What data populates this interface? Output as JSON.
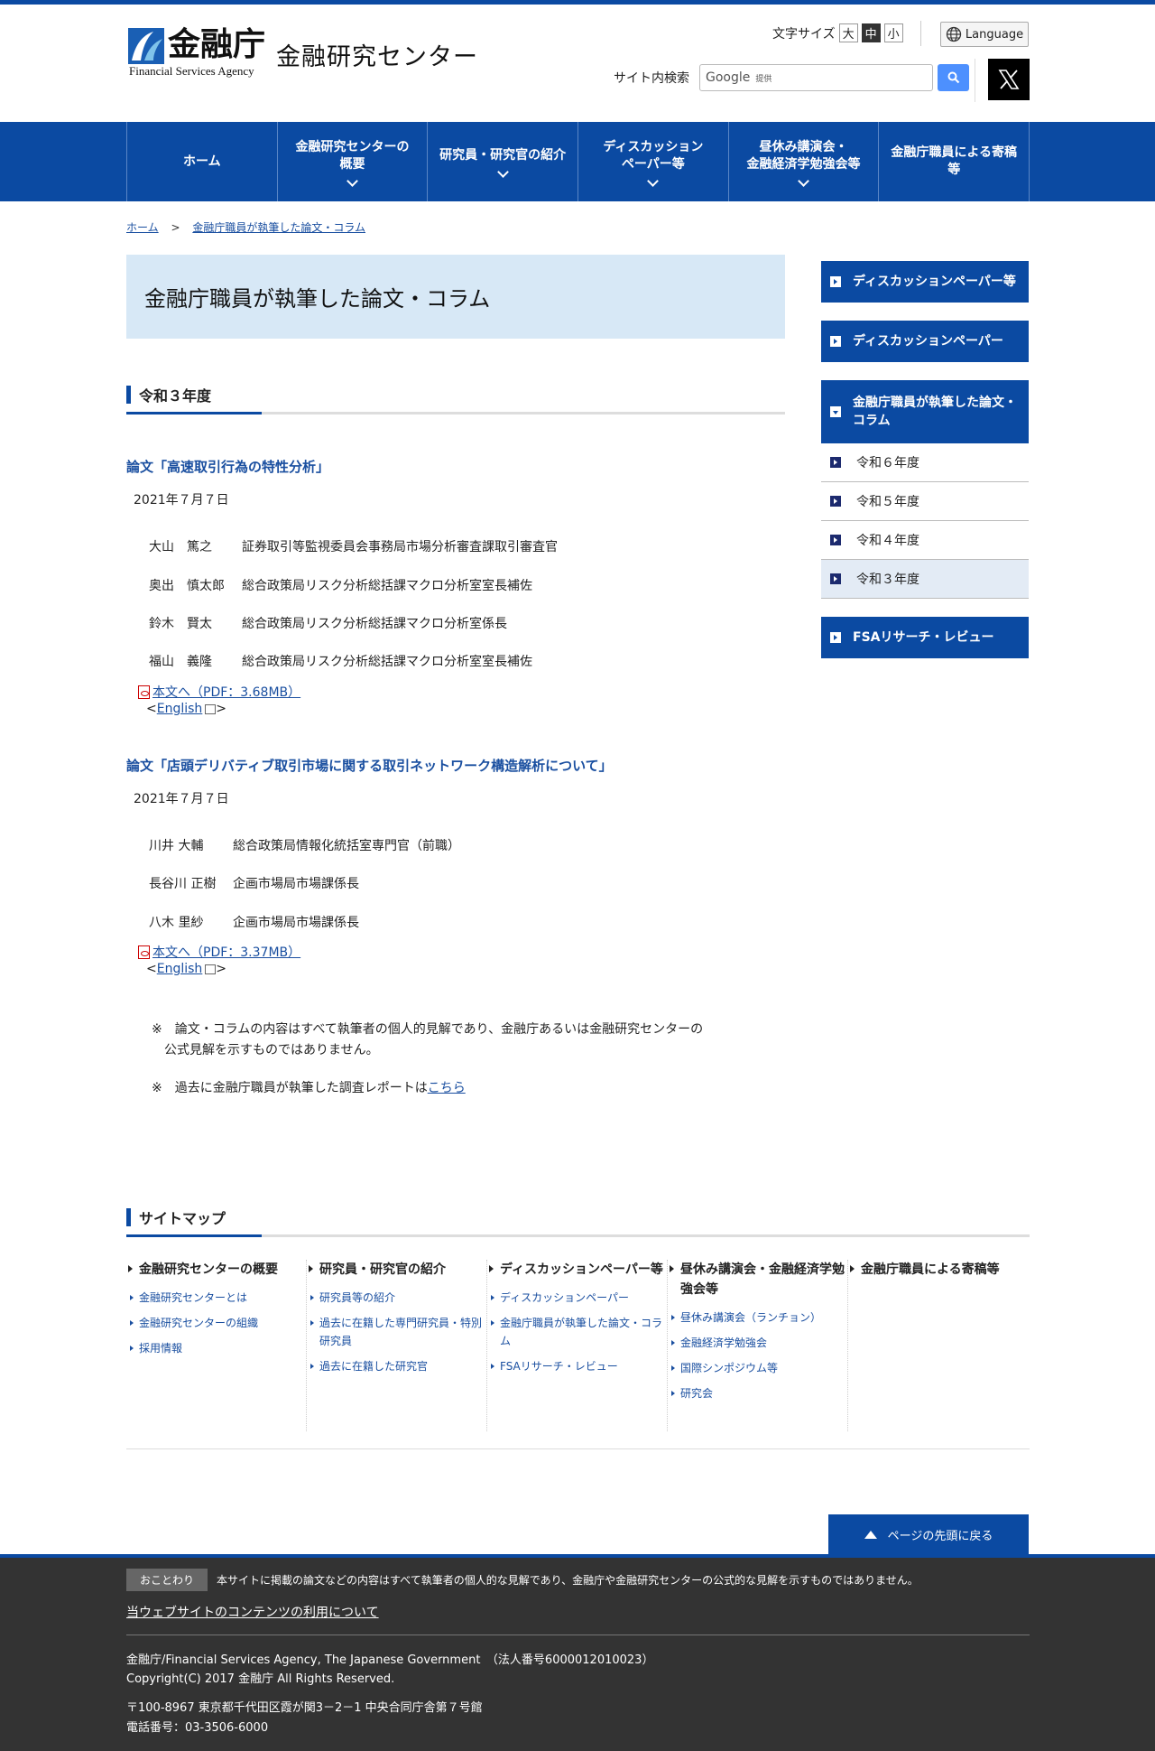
{
  "header": {
    "logo_main": "金融庁",
    "logo_sub": "Financial Services Agency",
    "logo_center": "金融研究センター",
    "font_size_label": "文字サイズ",
    "font_sizes": [
      "大",
      "中",
      "小"
    ],
    "language_label": "Language",
    "search_label": "サイト内検索",
    "search_placeholder_brand": "Google",
    "search_placeholder_note": "提供"
  },
  "nav": [
    {
      "label": "ホーム",
      "has_dropdown": false
    },
    {
      "label": "金融研究センターの\n概要",
      "has_dropdown": true
    },
    {
      "label": "研究員・研究官の紹介",
      "has_dropdown": true
    },
    {
      "label": "ディスカッション\nペーパー等",
      "has_dropdown": true
    },
    {
      "label": "昼休み講演会・\n金融経済学勉強会等",
      "has_dropdown": true
    },
    {
      "label": "金融庁職員による寄稿\n等",
      "has_dropdown": false
    }
  ],
  "breadcrumb": {
    "home": "ホーム",
    "sep": ">",
    "current": "金融庁職員が執筆した論文・コラム"
  },
  "page_title": "金融庁職員が執筆した論文・コラム",
  "section": {
    "heading": "令和３年度"
  },
  "papers": [
    {
      "title": "論文「高速取引行為の特性分析」",
      "date": "2021年７月７日",
      "authors": [
        {
          "name": "大山　篤之",
          "role": "証券取引等監視委員会事務局市場分析審査課取引審査官"
        },
        {
          "name": "奥出　慎太郎",
          "role": "総合政策局リスク分析総括課マクロ分析室室長補佐"
        },
        {
          "name": "鈴木　賢太",
          "role": "総合政策局リスク分析総括課マクロ分析室係長"
        },
        {
          "name": "福山　義隆",
          "role": "総合政策局リスク分析総括課マクロ分析室室長補佐"
        }
      ],
      "pdf_link": "本文へ（PDF：3.68MB）",
      "english": "English"
    },
    {
      "title": "論文「店頭デリバティブ取引市場に関する取引ネットワーク構造解析について」",
      "date": "2021年７月７日",
      "authors": [
        {
          "name": "川井 大輔",
          "role": "総合政策局情報化統括室専門官（前職）"
        },
        {
          "name": "長谷川 正樹",
          "role": "企画市場局市場課係長"
        },
        {
          "name": "八木 里紗",
          "role": "企画市場局市場課係長"
        }
      ],
      "pdf_link": "本文へ（PDF：3.37MB）",
      "english": "English"
    }
  ],
  "notes": {
    "note1_line1": "※　論文・コラムの内容はすべて執筆者の個人的見解であり、金融庁あるいは金融研究センターの",
    "note1_line2": "公式見解を示すものではありません。",
    "note2_text": "※　過去に金融庁職員が執筆した調査レポートは",
    "note2_link": "こちら"
  },
  "sidebar": {
    "top_buttons": [
      "ディスカッションペーパー等",
      "ディスカッションペーパー"
    ],
    "open_button": "金融庁職員が執筆した論文・コラム",
    "sub_items": [
      "令和６年度",
      "令和５年度",
      "令和４年度",
      "令和３年度"
    ],
    "bottom_button": "FSAリサーチ・レビュー"
  },
  "sitemap": {
    "heading": "サイトマップ",
    "columns": [
      {
        "head": "金融研究センターの概要",
        "links": [
          "金融研究センターとは",
          "金融研究センターの組織",
          "採用情報"
        ]
      },
      {
        "head": "研究員・研究官の紹介",
        "links": [
          "研究員等の紹介",
          "過去に在籍した専門研究員・特別研究員",
          "過去に在籍した研究官"
        ]
      },
      {
        "head": "ディスカッションペーパー等",
        "links": [
          "ディスカッションペーパー",
          "金融庁職員が執筆した論文・コラム",
          "FSAリサーチ・レビュー"
        ]
      },
      {
        "head": "昼休み講演会・金融経済学勉強会等",
        "links": [
          "昼休み講演会（ランチョン）",
          "金融経済学勉強会",
          "国際シンポジウム等",
          "研究会"
        ]
      },
      {
        "head": "金融庁職員による寄稿等",
        "links": []
      }
    ]
  },
  "to_top": "ページの先頭に戻る",
  "footer": {
    "disclaimer_tag": "おことわり",
    "disclaimer_text": "本サイトに掲載の論文などの内容はすべて執筆者の個人的な見解であり、金融庁や金融研究センターの公式的な見解を示すものではありません。",
    "terms_link": "当ウェブサイトのコンテンツの利用について",
    "agency": "金融庁/Financial Services Agency, The Japanese Government　（法人番号6000012010023）",
    "copyright": "Copyright(C) 2017 金融庁 All Rights Reserved.",
    "address": "〒100-8967 東京都千代田区霞が関3－2－1 中央合同庁舎第７号館",
    "phone": "電話番号：03-3506-6000"
  },
  "colors": {
    "brand": "#0b4aa2",
    "title_bg": "#d7e8f6",
    "footer_bg": "#333333"
  }
}
